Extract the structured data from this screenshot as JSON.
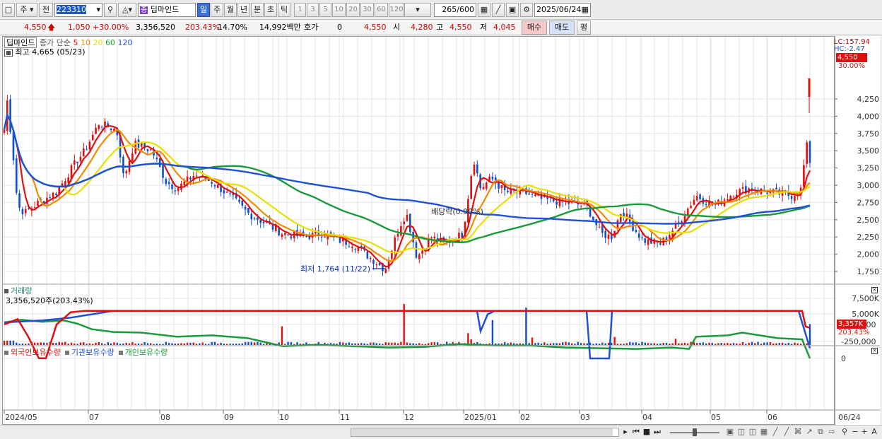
{
  "toolbar": {
    "market": "주",
    "scope": "전",
    "code": "223310",
    "stock_name": "딥마인드",
    "periods": [
      "일",
      "주",
      "월",
      "년",
      "분",
      "초",
      "틱"
    ],
    "selected_period": "일",
    "intervals": [
      "1",
      "3",
      "5",
      "10",
      "20",
      "30",
      "60",
      "120"
    ],
    "count_current": "265",
    "count_total": "/600",
    "date": "2025/06/24"
  },
  "quote": {
    "price": "4,550",
    "change": "1,050",
    "change_pct": "+30.00%",
    "volume": "3,356,520",
    "volume_ratio": "203.43%",
    "turnover": "14.70%",
    "amount": "14,992백만",
    "hoga_label": "호가",
    "hoga_value": "0",
    "hoga_price": "4,550",
    "open_label": "시",
    "open": "4,280",
    "high_label": "고",
    "high": "4,550",
    "low_label": "저",
    "low": "4,045",
    "buy_button": "매수",
    "sell_button": "매도",
    "eval_button": "평"
  },
  "price_panel": {
    "name": "딥마인드",
    "ma_label": "종가 단순",
    "ma_periods": [
      {
        "label": "5",
        "color": "#e01010"
      },
      {
        "label": "10",
        "color": "#f08c00"
      },
      {
        "label": "20",
        "color": "#e8e000"
      },
      {
        "label": "60",
        "color": "#1a9a3a"
      },
      {
        "label": "120",
        "color": "#2050d8"
      }
    ],
    "high_marker": "최고 4,665 (05/23)",
    "low_marker": "최저 1,764 (11/22)",
    "dividend_marker": "배당락(0.00%)",
    "lc_label": "LC:157.94",
    "hc_label": "HC:-2.47",
    "current_price_tag": "4,550",
    "current_pct_tag": "30.00%",
    "y_ticks": [
      "4,250",
      "4,000",
      "3,750",
      "3,500",
      "3,250",
      "3,000",
      "2,750",
      "2,500",
      "2,250",
      "2,000",
      "1,750"
    ]
  },
  "volume_panel": {
    "title": "거래량",
    "value_text": "3,356,520주(203.43%)",
    "y_ticks": [
      "7,500K",
      "5,000K"
    ],
    "current_tag": "3,357K",
    "current_pct_tag": "203.43%"
  },
  "holding_panel": {
    "series": [
      {
        "name": "외국인보유수량",
        "color": "#e01010"
      },
      {
        "name": "기관보유수량",
        "color": "#2050d8"
      },
      {
        "name": "개인보유수량",
        "color": "#1a9a3a"
      }
    ],
    "y_ticks": [
      "0",
      "-250,000",
      "-500,000"
    ]
  },
  "x_axis": {
    "labels": [
      "2024/05",
      "07",
      "08",
      "09",
      "10",
      "11",
      "12",
      "2025/01",
      "02",
      "03",
      "04",
      "05",
      "06"
    ],
    "current_date": "06/24"
  },
  "colors": {
    "up": "#e01010",
    "down": "#1050c8",
    "ma5": "#e01010",
    "ma10": "#f08c00",
    "ma20": "#e8e000",
    "ma60": "#1a9a3a",
    "ma120": "#2050d8"
  }
}
